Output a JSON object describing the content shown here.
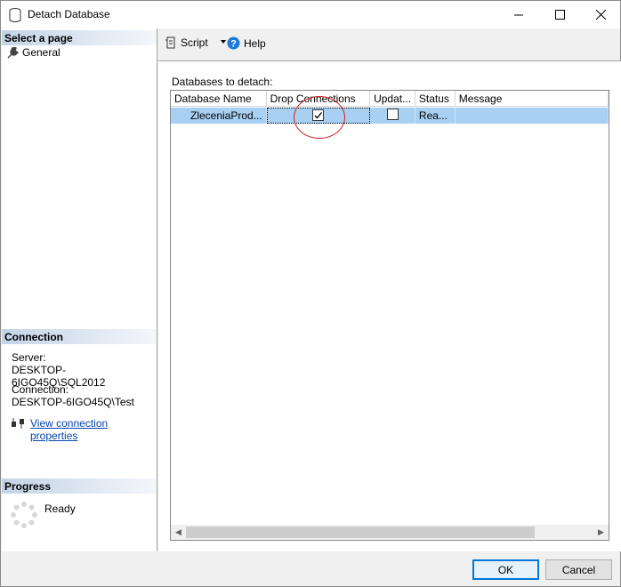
{
  "window": {
    "title": "Detach Database"
  },
  "sidebar": {
    "select_page_header": "Select a page",
    "pages": [
      {
        "label": "General",
        "icon": "wrench-icon"
      }
    ],
    "connection_header": "Connection",
    "server_label": "Server:",
    "server_value": "DESKTOP-6IGO45Q\\SQL2012",
    "connection_label": "Connection:",
    "connection_value": "DESKTOP-6IGO45Q\\Test",
    "view_connection_link": "View connection properties",
    "progress_header": "Progress",
    "progress_status": "Ready"
  },
  "toolbar": {
    "script_label": "Script",
    "help_label": "Help"
  },
  "grid": {
    "label": "Databases to detach:",
    "columns": [
      "Database Name",
      "Drop Connections",
      "Updat...",
      "Status",
      "Message"
    ],
    "rows": [
      {
        "database_name": "ZleceniaProd...",
        "drop_connections": true,
        "update_statistics": false,
        "status": "Rea...",
        "message": ""
      }
    ]
  },
  "buttons": {
    "ok": "OK",
    "cancel": "Cancel"
  },
  "colors": {
    "accent": "#0078d7",
    "selected_row": "#a8d0f2",
    "annotation": "#d42020",
    "link": "#0645ad"
  }
}
